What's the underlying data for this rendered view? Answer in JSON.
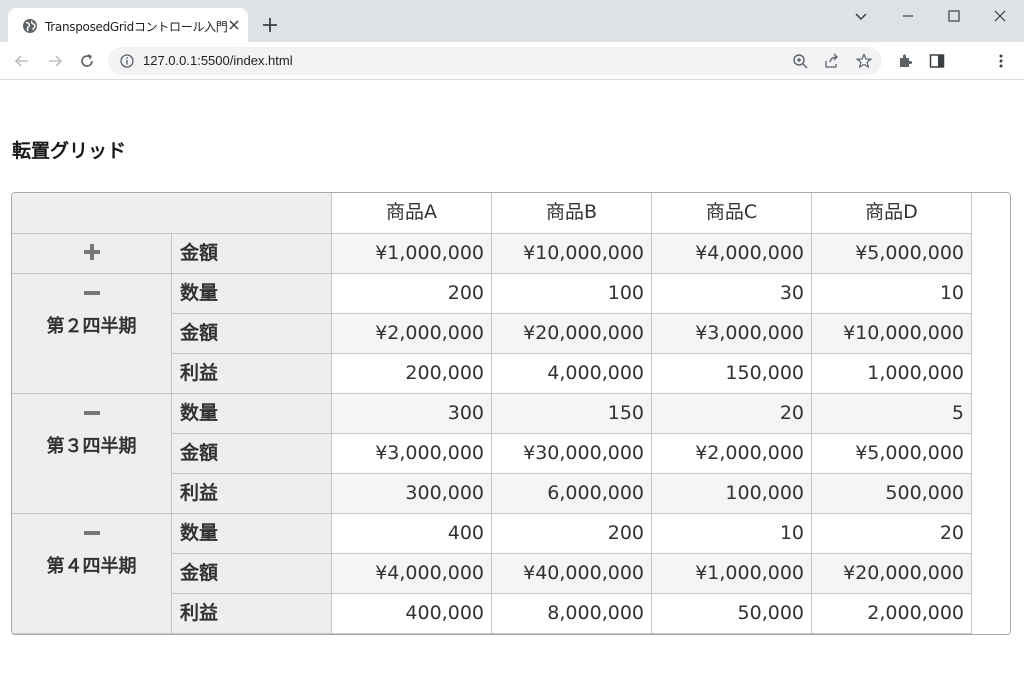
{
  "browser": {
    "tab_title": "TransposedGridコントロール入門",
    "url": "127.0.0.1:5500/index.html"
  },
  "page": {
    "title": "転置グリッド"
  },
  "grid": {
    "columns": [
      "商品A",
      "商品B",
      "商品C",
      "商品D"
    ],
    "groups": [
      {
        "label": "",
        "toggle": "plus",
        "rows": [
          {
            "label": "金額",
            "values": [
              "¥1,000,000",
              "¥10,000,000",
              "¥4,000,000",
              "¥5,000,000"
            ]
          }
        ]
      },
      {
        "label": "第２四半期",
        "toggle": "minus",
        "rows": [
          {
            "label": "数量",
            "values": [
              "200",
              "100",
              "30",
              "10"
            ]
          },
          {
            "label": "金額",
            "values": [
              "¥2,000,000",
              "¥20,000,000",
              "¥3,000,000",
              "¥10,000,000"
            ]
          },
          {
            "label": "利益",
            "values": [
              "200,000",
              "4,000,000",
              "150,000",
              "1,000,000"
            ]
          }
        ]
      },
      {
        "label": "第３四半期",
        "toggle": "minus",
        "rows": [
          {
            "label": "数量",
            "values": [
              "300",
              "150",
              "20",
              "5"
            ]
          },
          {
            "label": "金額",
            "values": [
              "¥3,000,000",
              "¥30,000,000",
              "¥2,000,000",
              "¥5,000,000"
            ]
          },
          {
            "label": "利益",
            "values": [
              "300,000",
              "6,000,000",
              "100,000",
              "500,000"
            ]
          }
        ]
      },
      {
        "label": "第４四半期",
        "toggle": "minus",
        "rows": [
          {
            "label": "数量",
            "values": [
              "400",
              "200",
              "10",
              "20"
            ]
          },
          {
            "label": "金額",
            "values": [
              "¥4,000,000",
              "¥40,000,000",
              "¥1,000,000",
              "¥20,000,000"
            ]
          },
          {
            "label": "利益",
            "values": [
              "400,000",
              "8,000,000",
              "50,000",
              "2,000,000"
            ]
          }
        ]
      }
    ]
  }
}
